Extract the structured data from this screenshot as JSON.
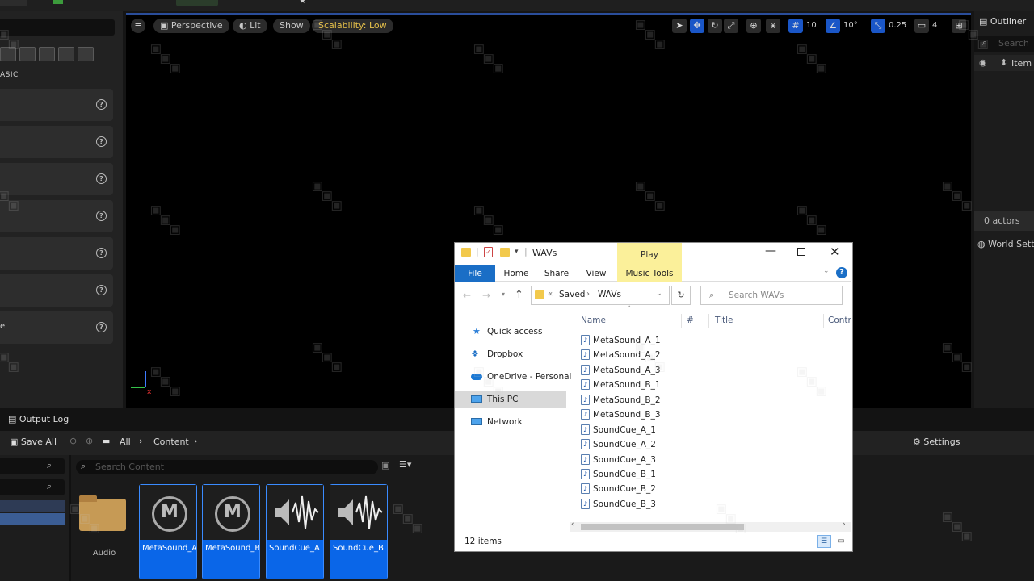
{
  "viewport": {
    "view_mode": "Perspective",
    "lit_label": "Lit",
    "show_label": "Show",
    "scalability": "Scalability: Low",
    "grid_snap": "10",
    "rotation_snap": "10°",
    "scale_snap": "0.25",
    "camera_speed": "4"
  },
  "left_panel": {
    "section_label": "ASIC",
    "partial_item": "e"
  },
  "outliner": {
    "title": "Outliner",
    "search_placeholder": "Search",
    "item_col": "Item",
    "actor_count": "0 actors",
    "world_settings": "World Setti"
  },
  "bottom": {
    "output_log": "Output Log",
    "save_all": "Save All",
    "path_all": "All",
    "path_content": "Content",
    "settings": "Settings",
    "search_placeholder": "Search Content",
    "folder_label": "Audio",
    "assets": [
      "MetaSound_A",
      "MetaSound_B",
      "SoundCue_A",
      "SoundCue_B"
    ]
  },
  "explorer": {
    "title": "WAVs",
    "play_tab": "Play",
    "tabs": [
      "File",
      "Home",
      "Share",
      "View",
      "Music Tools"
    ],
    "breadcrumb": [
      "Saved",
      "WAVs"
    ],
    "search_placeholder": "Search WAVs",
    "columns": [
      "Name",
      "#",
      "Title",
      "Contri"
    ],
    "nav": [
      "Quick access",
      "Dropbox",
      "OneDrive - Personal",
      "This PC",
      "Network"
    ],
    "files": [
      "MetaSound_A_1",
      "MetaSound_A_2",
      "MetaSound_A_3",
      "MetaSound_B_1",
      "MetaSound_B_2",
      "MetaSound_B_3",
      "SoundCue_A_1",
      "SoundCue_A_2",
      "SoundCue_A_3",
      "SoundCue_B_1",
      "SoundCue_B_2",
      "SoundCue_B_3"
    ],
    "status": "12 items"
  }
}
